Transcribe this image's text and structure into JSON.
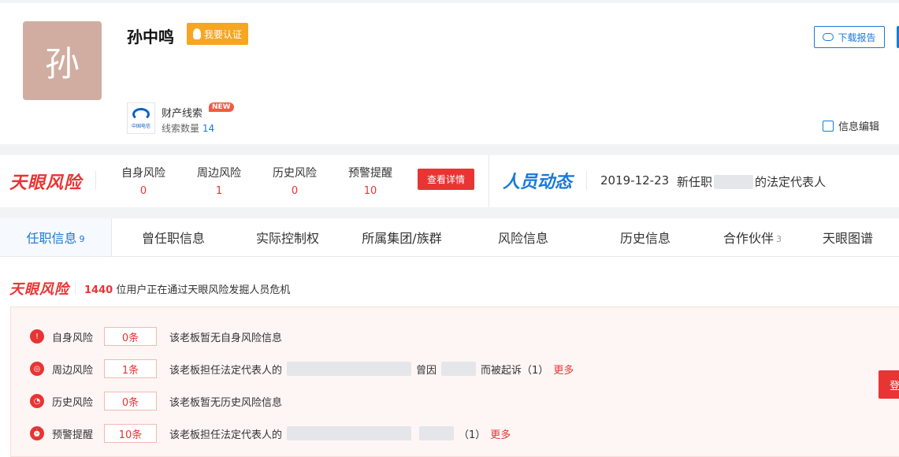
{
  "profile": {
    "avatar_char": "孙",
    "name": "孙中鸣",
    "verify_label": "我要认证",
    "clue_title": "财产线索",
    "new_badge": "NEW",
    "clue_count_label": "线索数量",
    "clue_count": "14",
    "download_label": "下载报告",
    "edit_label": "信息编辑",
    "logo_text": "中国电信"
  },
  "riskbar": {
    "logo": "天眼风险",
    "stats": [
      {
        "label": "自身风险",
        "value": "0"
      },
      {
        "label": "周边风险",
        "value": "1"
      },
      {
        "label": "历史风险",
        "value": "0"
      },
      {
        "label": "预警提醒",
        "value": "10"
      }
    ],
    "detail_button": "查看详情",
    "dynamic_logo": "人员动态",
    "dynamic_date": "2019-12-23",
    "dynamic_prefix": "新任职",
    "dynamic_suffix": "的法定代表人"
  },
  "tabs": [
    {
      "label": "任职信息",
      "count": "9"
    },
    {
      "label": "曾任职信息",
      "count": ""
    },
    {
      "label": "实际控制权",
      "count": ""
    },
    {
      "label": "所属集团/族群",
      "count": ""
    },
    {
      "label": "风险信息",
      "count": ""
    },
    {
      "label": "历史信息",
      "count": ""
    },
    {
      "label": "合作伙伴",
      "count": "3"
    },
    {
      "label": "天眼图谱",
      "count": ""
    }
  ],
  "risk_section": {
    "logo": "天眼风险",
    "users": "1440",
    "desc": "位用户正在通过天眼风险发掘人员危机",
    "rows": [
      {
        "label": "自身风险",
        "count": "0条",
        "text": "该老板暂无自身风险信息"
      },
      {
        "label": "周边风险",
        "count": "1条",
        "text": "该老板担任法定代表人的",
        "mid": "曾因",
        "tail": "而被起诉（1）",
        "more": "更多"
      },
      {
        "label": "历史风险",
        "count": "0条",
        "text": "该老板暂无历史风险信息"
      },
      {
        "label": "预警提醒",
        "count": "10条",
        "text": "该老板担任法定代表人的",
        "tail": "（1）",
        "more": "更多"
      }
    ],
    "side_button": "登"
  }
}
